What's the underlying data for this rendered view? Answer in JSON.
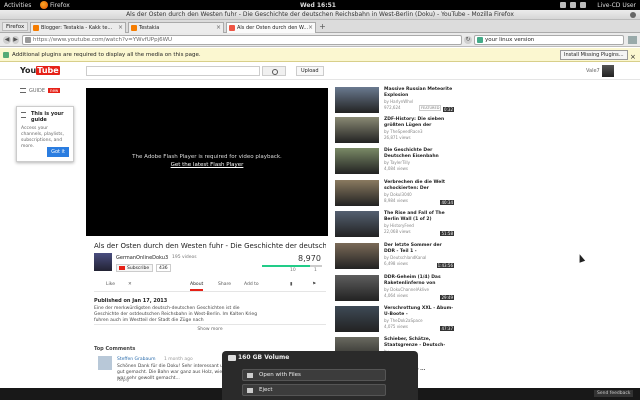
{
  "topbar": {
    "activities": "Activities",
    "app": "Firefox",
    "clock": "Wed 16:51",
    "user": "Live-CD User"
  },
  "window_title": "Als der Osten durch den Westen fuhr - Die Geschichte der deutschen Reichsbahn in West-Berlin (Doku) - YouTube - Mozilla Firefox",
  "tabs": {
    "menu": "Firefox",
    "items": [
      {
        "label": "Blogger: Testakia - Kakk te..."
      },
      {
        "label": "Testakia"
      },
      {
        "label": "Als der Osten durch den W..."
      }
    ]
  },
  "nav": {
    "url": "https://www.youtube.com/watch?v=YWvfUPpj6WU",
    "search": "your linux version"
  },
  "plugin_bar": {
    "message": "Additional plugins are required to display all the media on this page.",
    "button": "Install Missing Plugins..."
  },
  "youtube": {
    "logo_you": "You",
    "logo_tube": "Tube",
    "upload": "Upload",
    "user": "Vale7"
  },
  "guide": {
    "label": "GUIDE",
    "badge": "new",
    "pop_title": "This is your guide",
    "pop_body": "Access your channels, playlists, subscriptions, and more.",
    "got_it": "Got it"
  },
  "player": {
    "message": "The Adobe Flash Player is required for video playback.",
    "link": "Get the latest Flash Player"
  },
  "video": {
    "title": "Als der Osten durch den Westen fuhr - Die Geschichte der deutschen Reichsbahn...",
    "channel": "GermanOnlineDoku3",
    "video_count": "195 videos",
    "subscribe": "Subscribe",
    "subscribers": "436",
    "views": "8,970",
    "views_fill": 0.8,
    "likes": "10",
    "dislikes": "1",
    "like_label": "Like",
    "actions": [
      "About",
      "Share",
      "Add to"
    ],
    "published": "Published on Jan 17, 2013",
    "description": "Eine der merkwürdigsten deutsch-deutschen Geschichten ist die Geschichte der ostdeutschen Reichsbahn in West-Berlin. Im Kalten Krieg fuhren auch im Westteil der Stadt die Züge nach",
    "show_more": "Show more"
  },
  "comments": {
    "header": "Top Comments",
    "name": "Steffen Grabaum",
    "time": "1 month ago",
    "text": "Schönen Dank für die Doku! Sehr interessant und gut gemacht. Die Bahn war ganz aus Holz, wie es war sehr gewollt gemacht...",
    "reply": "Reply"
  },
  "related": [
    {
      "title": "Massive Russian Meteorite Explosion",
      "by": "by HarlynWhvl",
      "views": "972,624",
      "dur": "0:32",
      "badge": "FEATURED",
      "color": "#6a7a90"
    },
    {
      "title": "ZDF-History: Die sieben größten Lügen der",
      "by": "by TheSpeedRace3",
      "views": "26,871 views",
      "dur": "",
      "badge": "",
      "color": "#8a8a74"
    },
    {
      "title": "Die Geschichte Der Deutschen Eisenbahn",
      "by": "by TaylerTilly",
      "views": "4,084 views",
      "dur": "",
      "badge": "",
      "color": "#7a8a66"
    },
    {
      "title": "Verbrechen die die Welt schockierten: Der",
      "by": "by Dokul3040",
      "views": "8,984 views",
      "dur": "40:34",
      "badge": "",
      "color": "#8a7a60"
    },
    {
      "title": "The Rise and Fall of The Berlin Wall (1 of 2)",
      "by": "by HistoryFeed",
      "views": "22,068 views",
      "dur": "51:58",
      "badge": "",
      "color": "#556070"
    },
    {
      "title": "Der letzte Sommer der DDR - Teil 1 -",
      "by": "by DeutschlandKanal",
      "views": "6,498 views",
      "dur": "1:43:56",
      "badge": "",
      "color": "#7a6a58"
    },
    {
      "title": "DDR-Geheim (1/4) Das Raketenlinferno von",
      "by": "by DokuChannelAklive",
      "views": "4,064 views",
      "dur": "29:49",
      "badge": "",
      "color": "#5e5e5e"
    },
    {
      "title": "Verschrottung XXL - Abum-U-Boote -",
      "by": "by TheDok2aSpace",
      "views": "4,075 views",
      "dur": "47:37",
      "badge": "",
      "color": "#3e4a56"
    },
    {
      "title": "Schieber, Schätze, Staatsgrenze - Deutsch-",
      "by": "by ...",
      "views": "",
      "dur": "",
      "badge": "",
      "color": "#6a6a60"
    },
    {
      "title": "... Geschichte ... ",
      "by": "",
      "views": "",
      "dur": "",
      "badge": "",
      "color": "#4a4a40"
    }
  ],
  "volume": {
    "name": "160 GB Volume",
    "open": "Open with Files",
    "eject": "Eject"
  },
  "send_feedback": "Send feedback"
}
